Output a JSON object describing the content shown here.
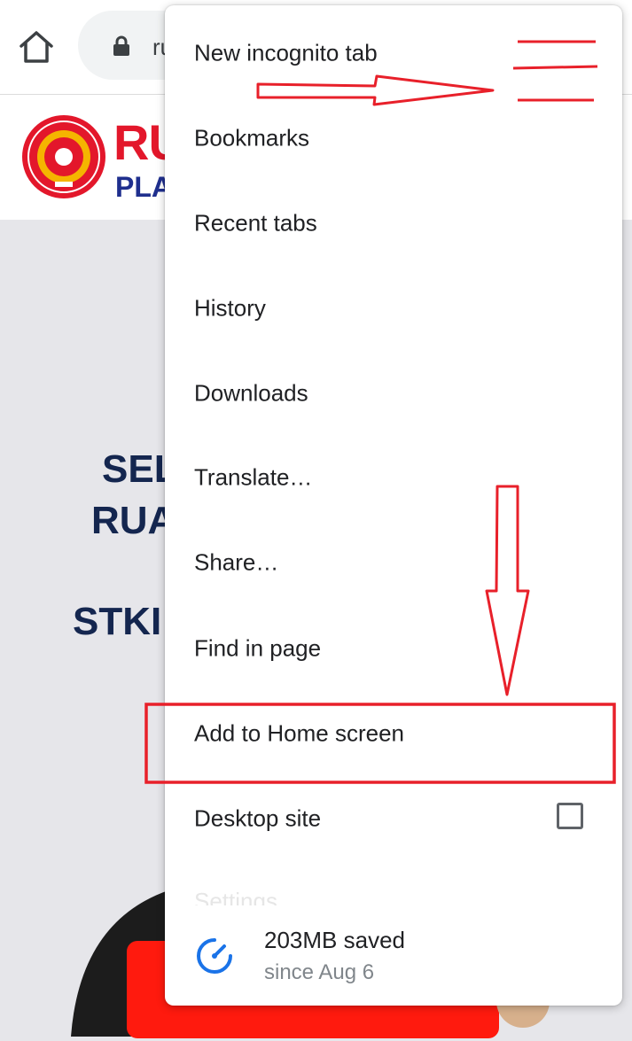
{
  "toolbar": {
    "url_text": "ru",
    "home_icon": "home-icon",
    "lock_icon": "lock-icon"
  },
  "site": {
    "brand_top": "RU",
    "brand_bottom": "PLA",
    "logo_icon": "university-seal-logo"
  },
  "hero": {
    "line1": "SEL",
    "line2": "RUA",
    "line3": "STKI"
  },
  "menu": {
    "items": [
      {
        "label": "New incognito tab"
      },
      {
        "label": "Bookmarks"
      },
      {
        "label": "Recent tabs"
      },
      {
        "label": "History"
      },
      {
        "label": "Downloads"
      },
      {
        "label": "Translate…"
      },
      {
        "label": "Share…"
      },
      {
        "label": "Find in page"
      },
      {
        "label": "Add to Home screen"
      },
      {
        "label": "Desktop site",
        "checked": false
      }
    ],
    "faded_item": "Settings",
    "savings": {
      "title": "203MB saved",
      "subtitle": "since Aug 6",
      "icon": "speedometer-icon"
    }
  },
  "colors": {
    "annotation_red": "#e8202a",
    "hero_text": "#14264f",
    "brand_red": "#e3172b",
    "brand_blue": "#1f2f8e",
    "savings_icon_blue": "#1a73e8"
  }
}
